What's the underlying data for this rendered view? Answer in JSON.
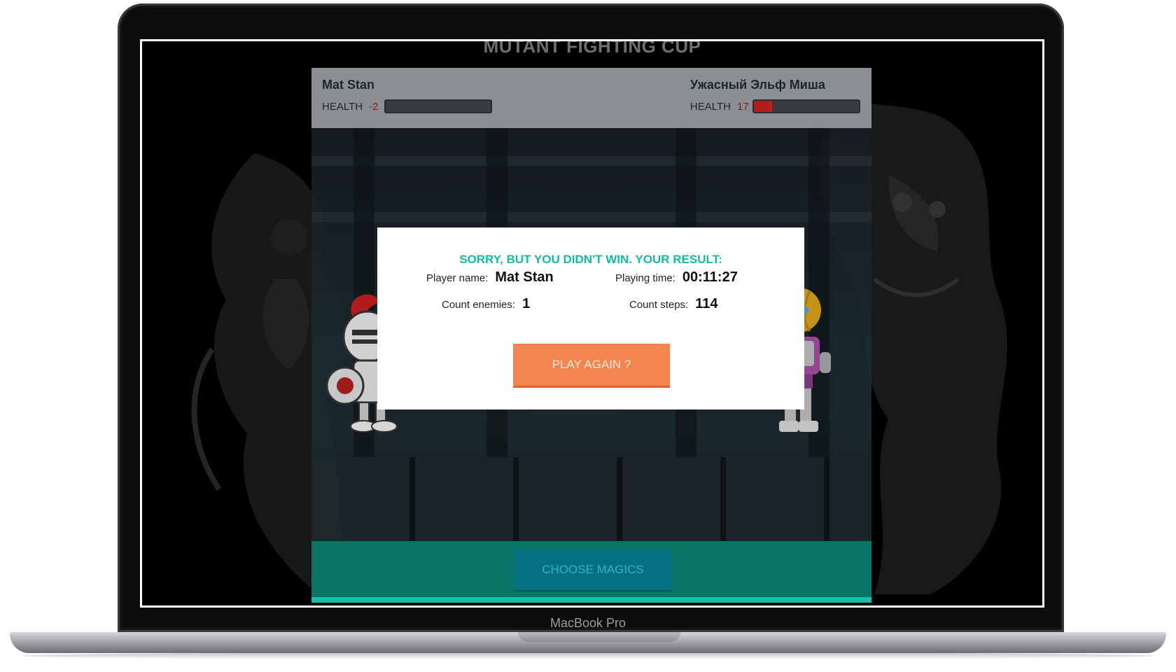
{
  "device": {
    "brand_label": "MacBook Pro"
  },
  "page": {
    "title": "MUTANT FIGHTING CUP"
  },
  "player": {
    "name": "Mat Stan",
    "health_label": "HEALTH",
    "health_value": "-2",
    "health_fraction": 0
  },
  "enemy": {
    "name": "Ужасный Эльф Миша",
    "health_label": "HEALTH",
    "health_value": "17",
    "health_fraction": 0.17
  },
  "result_modal": {
    "title": "SORRY, BUT YOU DIDN'T WIN. YOUR RESULT:",
    "player_name_label": "Player name:",
    "player_name_value": "Mat Stan",
    "playing_time_label": "Playing time:",
    "playing_time_value": "00:11:27",
    "count_enemies_label": "Count enemies:",
    "count_enemies_value": "1",
    "count_steps_label": "Count steps:",
    "count_steps_value": "114",
    "play_again_label": "PLAY AGAIN ?"
  },
  "controls": {
    "choose_magics_label": "CHOOSE MAGICS"
  },
  "colors": {
    "accent_teal": "#19b9a0",
    "play_button": "#f3864f",
    "health_fill": "#b51c1c",
    "bottom_bar": "#077465",
    "hud_background": "#8a8f93"
  }
}
